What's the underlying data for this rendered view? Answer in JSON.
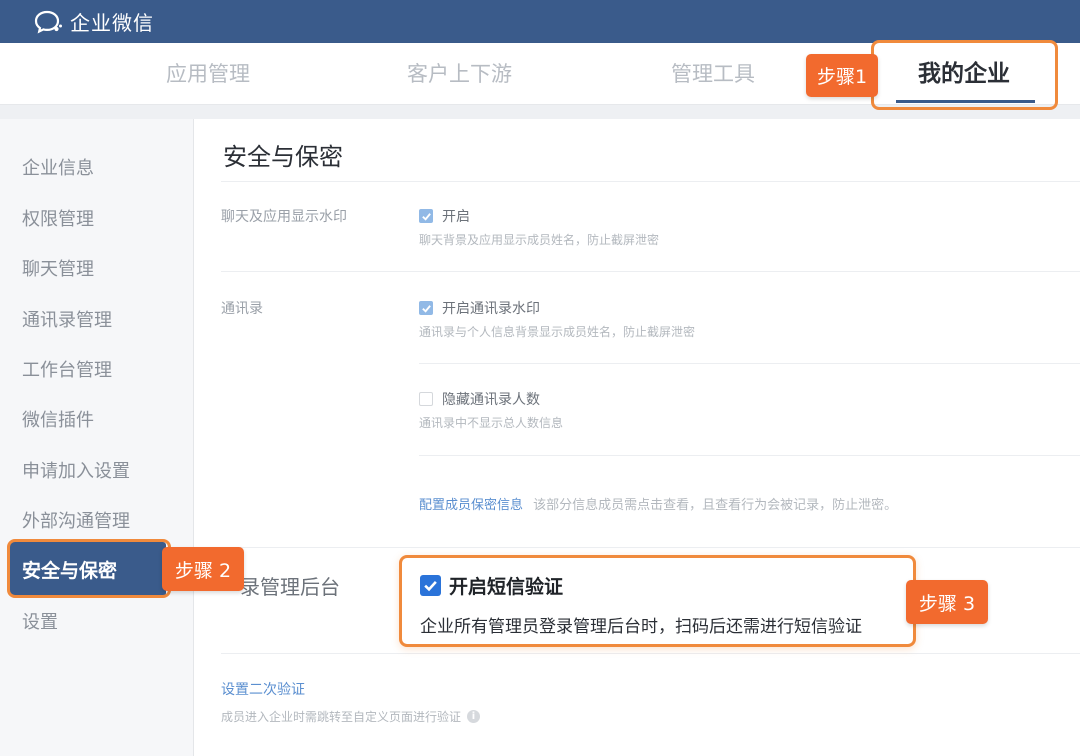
{
  "titlebar": {
    "app_name": "企业微信",
    "logo_icon": "wecom-chat-bubble-icon"
  },
  "topnav": {
    "tabs": [
      "应用管理",
      "客户上下游",
      "管理工具",
      "我的企业"
    ],
    "active_tab": "我的企业",
    "accent": "#3a5b8b"
  },
  "sidebar": {
    "items": [
      "企业信息",
      "权限管理",
      "聊天管理",
      "通讯录管理",
      "工作台管理",
      "微信插件",
      "申请加入设置",
      "外部沟通管理",
      "安全与保密",
      "设置"
    ],
    "active_item": "安全与保密"
  },
  "main": {
    "title": "安全与保密",
    "watermark": {
      "label": "聊天及应用显示水印",
      "option": "开启",
      "checked": true,
      "desc": "聊天背景及应用显示成员姓名，防止截屏泄密"
    },
    "contacts": {
      "label": "通讯录",
      "opt1": {
        "text": "开启通讯录水印",
        "checked": true,
        "desc": "通讯录与个人信息背景显示成员姓名，防止截屏泄密"
      },
      "opt2": {
        "text": "隐藏通讯录人数",
        "checked": false,
        "desc": "通讯录中不显示总人数信息"
      },
      "config_link": "配置成员保密信息",
      "config_desc": "该部分信息成员需点击查看，且查看行为会被记录，防止泄密。"
    },
    "login": {
      "label": "录管理后台",
      "sms_option": "开启短信验证",
      "sms_checked": true,
      "sms_desc": "企业所有管理员登录管理后台时，扫码后还需进行短信验证"
    },
    "second_verify": {
      "link": "设置二次验证",
      "desc": "成员进入企业时需跳转至自定义页面进行验证"
    }
  },
  "annotations": {
    "step1": "步骤1",
    "step2": "步骤 2",
    "step3": "步骤 3",
    "highlight_color": "#f08a3c",
    "badge_color": "#f26a2e"
  }
}
